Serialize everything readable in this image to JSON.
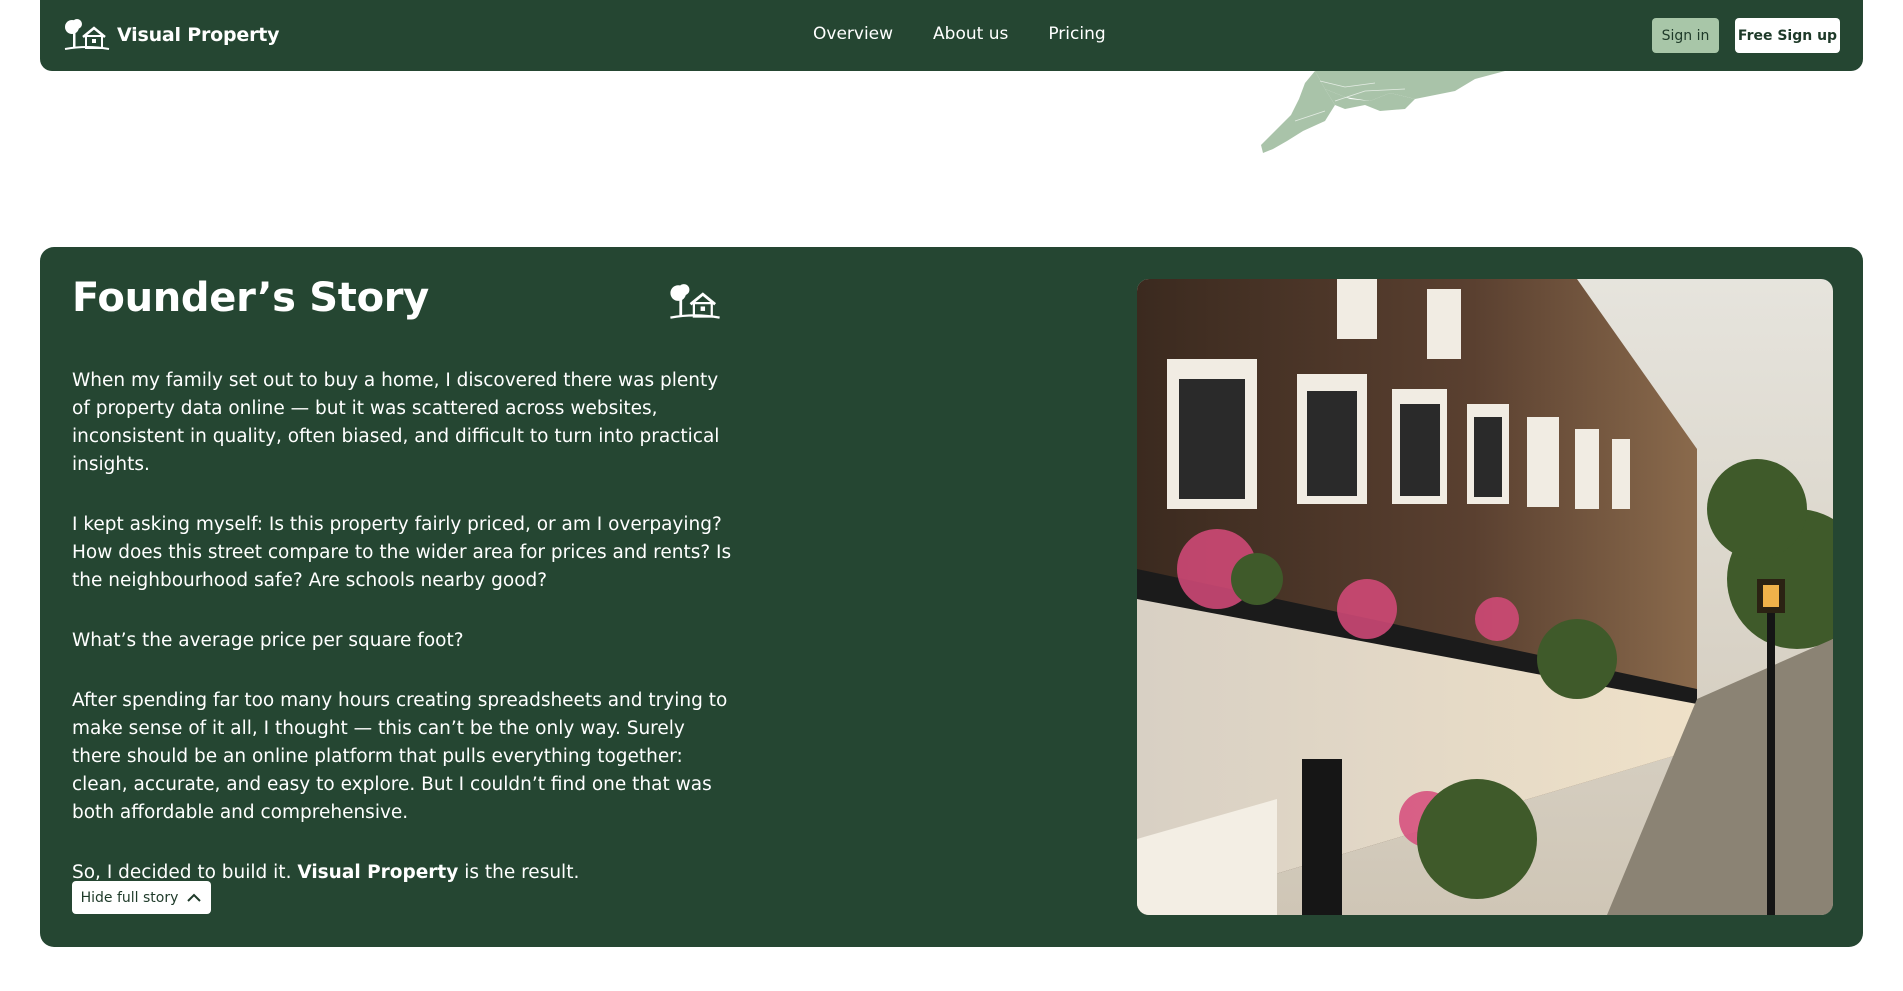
{
  "header": {
    "brand": "Visual Property",
    "nav": [
      {
        "label": "Overview"
      },
      {
        "label": "About us"
      },
      {
        "label": "Pricing"
      }
    ],
    "sign_in_label": "Sign in",
    "sign_up_label": "Free Sign up"
  },
  "story": {
    "title": "Founder’s Story",
    "paragraphs": [
      "When my family set out to buy a home, I discovered there was plenty of property data online — but it was scattered across websites, inconsistent in quality, often biased, and difficult to turn into practical insights.",
      "I kept asking myself: Is this property fairly priced, or am I overpaying? How does this street compare to the wider area for prices and rents? Is the neighbourhood safe? Are schools nearby good?",
      "What’s the average price per square foot?",
      "After spending far too many hours creating spreadsheets and trying to make sense of it all, I thought — this can’t be the only way. Surely there should be an online platform that pulls everything together: clean, accurate, and easy to explore. But I couldn’t find one that was both affordable and comprehensive."
    ],
    "closing_prefix": "So, I decided to build it. ",
    "closing_brand": "Visual Property",
    "closing_suffix": " is the result.",
    "hide_button_label": "Hide full story"
  },
  "icons": {
    "logo": "tree-house-logo-icon",
    "chevron": "chevron-up-icon"
  },
  "colors": {
    "brand_green": "#254632",
    "accent_green": "#a8c6a8",
    "text_light": "#ffffff"
  }
}
